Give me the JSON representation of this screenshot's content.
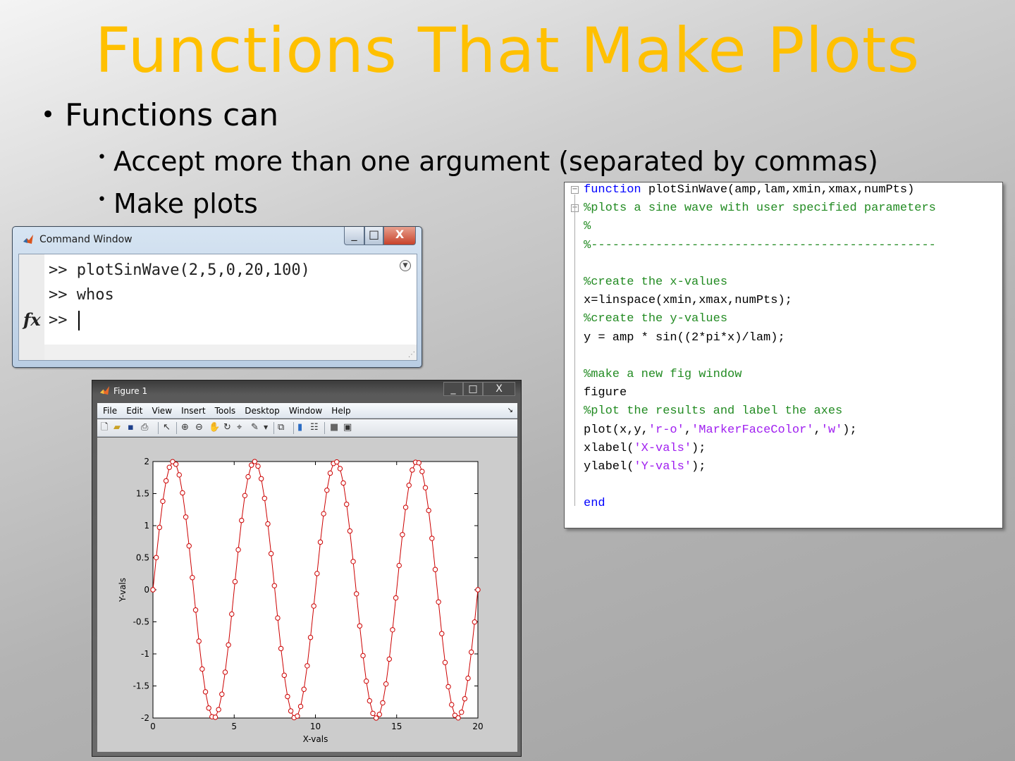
{
  "slide": {
    "title": "Functions That Make Plots",
    "bullet1": "Functions can",
    "bullet2a": "Accept more than one argument (separated by commas)",
    "bullet2b": "Make plots"
  },
  "command_window": {
    "title": "Command Window",
    "prompt": ">>",
    "lines": [
      "plotSinWave(2,5,0,20,100)",
      "whos",
      ""
    ],
    "fx_label": "fx"
  },
  "editor": {
    "lines": [
      {
        "parts": [
          {
            "t": "function",
            "c": "kw"
          },
          {
            "t": " plotSinWave(amp,lam,xmin,xmax,numPts)",
            "c": ""
          }
        ]
      },
      {
        "parts": [
          {
            "t": "%plots a sine wave with user specified parameters",
            "c": "cm"
          }
        ]
      },
      {
        "parts": [
          {
            "t": "%",
            "c": "cm"
          }
        ]
      },
      {
        "parts": [
          {
            "t": "%------------------------------------------------",
            "c": "cm"
          }
        ]
      },
      {
        "parts": []
      },
      {
        "parts": [
          {
            "t": "%create the x-values",
            "c": "cm"
          }
        ]
      },
      {
        "parts": [
          {
            "t": "x=linspace(xmin,xmax,numPts);",
            "c": ""
          }
        ]
      },
      {
        "parts": [
          {
            "t": "%create the y-values",
            "c": "cm"
          }
        ]
      },
      {
        "parts": [
          {
            "t": "y = amp * sin((2*pi*x)/lam);",
            "c": ""
          }
        ]
      },
      {
        "parts": []
      },
      {
        "parts": [
          {
            "t": "%make a new fig window",
            "c": "cm"
          }
        ]
      },
      {
        "parts": [
          {
            "t": "figure",
            "c": ""
          }
        ]
      },
      {
        "parts": [
          {
            "t": "%plot the results and label the axes",
            "c": "cm"
          }
        ]
      },
      {
        "parts": [
          {
            "t": "plot(x,y,",
            "c": ""
          },
          {
            "t": "'r-o'",
            "c": "st"
          },
          {
            "t": ",",
            "c": ""
          },
          {
            "t": "'MarkerFaceColor'",
            "c": "st"
          },
          {
            "t": ",",
            "c": ""
          },
          {
            "t": "'w'",
            "c": "st"
          },
          {
            "t": ");",
            "c": ""
          }
        ]
      },
      {
        "parts": [
          {
            "t": "xlabel(",
            "c": ""
          },
          {
            "t": "'X-vals'",
            "c": "st"
          },
          {
            "t": ");",
            "c": ""
          }
        ]
      },
      {
        "parts": [
          {
            "t": "ylabel(",
            "c": ""
          },
          {
            "t": "'Y-vals'",
            "c": "st"
          },
          {
            "t": ");",
            "c": ""
          }
        ]
      },
      {
        "parts": []
      },
      {
        "parts": [
          {
            "t": "end",
            "c": "kw"
          }
        ]
      }
    ]
  },
  "figure_window": {
    "title": "Figure 1",
    "menus": [
      "File",
      "Edit",
      "View",
      "Insert",
      "Tools",
      "Desktop",
      "Window",
      "Help"
    ],
    "toolbar_icons": [
      "new-figure-icon",
      "open-file-icon",
      "save-icon",
      "print-icon",
      "select-arrow-icon",
      "zoom-in-icon",
      "zoom-out-icon",
      "pan-hand-icon",
      "rotate-3d-icon",
      "data-cursor-icon",
      "brush-icon",
      "link-plot-icon",
      "colorbar-icon",
      "legend-icon",
      "hide-plot-tools-icon",
      "show-plot-tools-icon"
    ]
  },
  "chart_data": {
    "type": "line",
    "xlabel": "X-vals",
    "ylabel": "Y-vals",
    "xlim": [
      0,
      20
    ],
    "ylim": [
      -2,
      2
    ],
    "xticks": [
      "0",
      "5",
      "10",
      "15",
      "20"
    ],
    "yticks": [
      "-2",
      "-1.5",
      "-1",
      "-0.5",
      "0",
      "0.5",
      "1",
      "1.5",
      "2"
    ],
    "series": [
      {
        "amplitude": 2,
        "wavelength": 5,
        "xmin": 0,
        "xmax": 20,
        "num_points": 100,
        "line_color": "#cc0000",
        "marker": "o",
        "marker_face_color": "#ffffff"
      }
    ]
  }
}
